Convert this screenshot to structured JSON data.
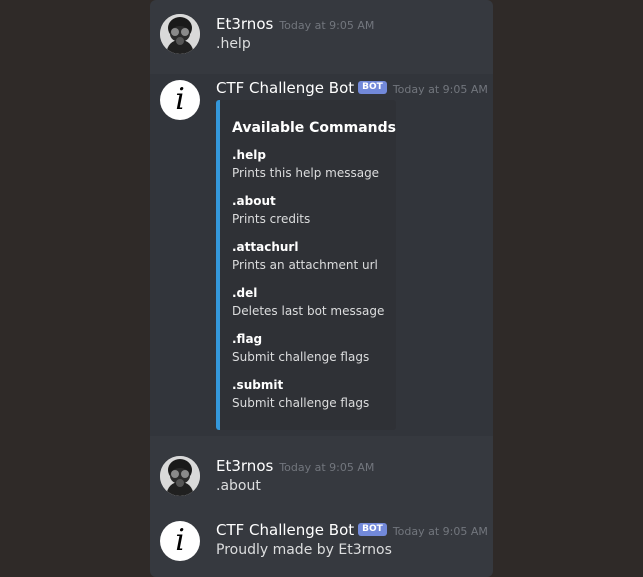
{
  "messages": [
    {
      "username": "Et3rnos",
      "timestamp": "Today at 9:05 AM",
      "content": ".help"
    },
    {
      "username": "CTF Challenge Bot",
      "badge": "BOT",
      "timestamp": "Today at 9:05 AM"
    },
    {
      "username": "Et3rnos",
      "timestamp": "Today at 9:05 AM",
      "content": ".about"
    },
    {
      "username": "CTF Challenge Bot",
      "badge": "BOT",
      "timestamp": "Today at 9:05 AM",
      "content": "Proudly made by Et3rnos"
    }
  ],
  "embed": {
    "title": "Available Commands",
    "accent": "#3498db",
    "fields": [
      {
        "name": ".help",
        "value": "Prints this help message"
      },
      {
        "name": ".about",
        "value": "Prints credits"
      },
      {
        "name": ".attachurl",
        "value": "Prints an attachment url"
      },
      {
        "name": ".del",
        "value": "Deletes last bot message"
      },
      {
        "name": ".flag",
        "value": "Submit challenge flags"
      },
      {
        "name": ".submit",
        "value": "Submit challenge flags"
      }
    ]
  },
  "icons": {
    "user_avatar": "gas-mask-avatar-icon",
    "bot_avatar": "info-icon",
    "bot_avatar_glyph": "i"
  }
}
